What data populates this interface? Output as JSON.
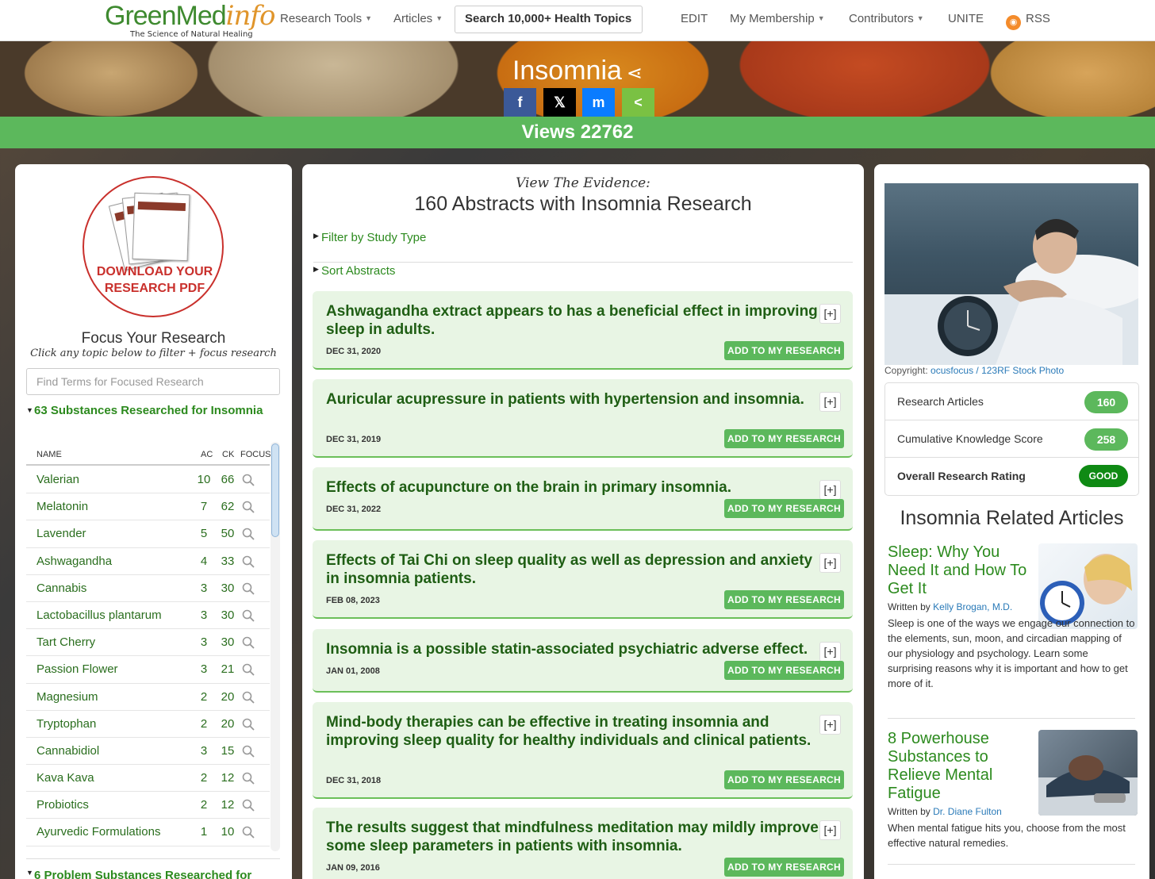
{
  "logo": {
    "part1": "GreenMed",
    "part2": "info",
    "tagline": "The Science of Natural Healing"
  },
  "nav": {
    "research_tools": "Research Tools",
    "articles": "Articles",
    "search": "Search 10,000+ Health Topics",
    "edit": "EDIT",
    "membership": "My Membership",
    "contributors": "Contributors",
    "unite": "UNITE",
    "rss": "RSS"
  },
  "hero": {
    "title": "Insomnia",
    "views": "Views 22762"
  },
  "social": {
    "facebook": "f",
    "twitter": "𝕏",
    "messenger": "m",
    "share": "<"
  },
  "left": {
    "pdf_line1": "DOWNLOAD YOUR",
    "pdf_line2": "RESEARCH PDF",
    "focus_title": "Focus Your Research",
    "focus_sub": "Click any topic below to filter + focus research",
    "find_placeholder": "Find Terms for Focused Research",
    "subs_heading": "63 Substances Researched for Insomnia",
    "columns": {
      "name": "NAME",
      "ac": "AC",
      "ck": "CK",
      "focus": "FOCUS"
    },
    "substances": [
      {
        "name": "Valerian",
        "ac": "10",
        "ck": "66"
      },
      {
        "name": "Melatonin",
        "ac": "7",
        "ck": "62"
      },
      {
        "name": "Lavender",
        "ac": "5",
        "ck": "50"
      },
      {
        "name": "Ashwagandha",
        "ac": "4",
        "ck": "33"
      },
      {
        "name": "Cannabis",
        "ac": "3",
        "ck": "30"
      },
      {
        "name": "Lactobacillus plantarum",
        "ac": "3",
        "ck": "30"
      },
      {
        "name": "Tart Cherry",
        "ac": "3",
        "ck": "30"
      },
      {
        "name": "Passion Flower",
        "ac": "3",
        "ck": "21"
      },
      {
        "name": "Magnesium",
        "ac": "2",
        "ck": "20"
      },
      {
        "name": "Tryptophan",
        "ac": "2",
        "ck": "20"
      },
      {
        "name": "Cannabidiol",
        "ac": "3",
        "ck": "15"
      },
      {
        "name": "Kava Kava",
        "ac": "2",
        "ck": "12"
      },
      {
        "name": "Probiotics",
        "ac": "2",
        "ck": "12"
      },
      {
        "name": "Ayurvedic Formulations",
        "ac": "1",
        "ck": "10"
      }
    ],
    "problem_heading": "6 Problem Substances Researched for"
  },
  "middle": {
    "evidence_sub": "View The Evidence:",
    "evidence_title": "160 Abstracts with Insomnia Research",
    "filter_label": "Filter by Study Type",
    "sort_label": "Sort Abstracts",
    "add_label": "ADD TO MY RESEARCH",
    "expand_label": "[+]",
    "abstracts": [
      {
        "title": "Ashwagandha extract appears to has a beneficial effect in improving sleep in adults.",
        "date": "DEC 31, 2020"
      },
      {
        "title": "Auricular acupressure in patients with hypertension and insomnia.",
        "date": "DEC 31, 2019"
      },
      {
        "title": "Effects of acupuncture on the brain in primary insomnia.",
        "date": "DEC 31, 2022"
      },
      {
        "title": "Effects of Tai Chi on sleep quality as well as depression and anxiety in insomnia patients.",
        "date": "FEB 08, 2023"
      },
      {
        "title": "Insomnia is a possible statin-associated psychiatric adverse effect.",
        "date": "JAN 01, 2008"
      },
      {
        "title": "Mind-body therapies can be effective in treating insomnia and improving sleep quality for healthy individuals and clinical patients.",
        "date": "DEC 31, 2018"
      },
      {
        "title": "The results suggest that mindfulness meditation may mildly improve some sleep parameters in patients with insomnia.",
        "date": "JAN 09, 2016"
      }
    ]
  },
  "right": {
    "copyright_label": "Copyright:",
    "copyright_link": "ocusfocus / 123RF Stock Photo",
    "stats": [
      {
        "label": "Research Articles",
        "value": "160"
      },
      {
        "label": "Cumulative Knowledge Score",
        "value": "258"
      },
      {
        "label": "Overall Research Rating",
        "value": "GOOD"
      }
    ],
    "related_title": "Insomnia Related Articles",
    "articles": [
      {
        "title": "Sleep: Why You Need It and How To Get It",
        "written_by": "Written by",
        "author": "Kelly Brogan, M.D.",
        "desc": "Sleep is one of the ways we engage our connection to the elements, sun, moon, and circadian mapping of our physiology and psychology. Learn some surprising reasons why it is important and how to get more of it."
      },
      {
        "title": "8 Powerhouse Substances to Relieve Mental Fatigue",
        "written_by": "Written by",
        "author": "Dr. Diane Fulton",
        "desc": "When mental fatigue hits you, choose from the most effective natural remedies."
      }
    ]
  }
}
